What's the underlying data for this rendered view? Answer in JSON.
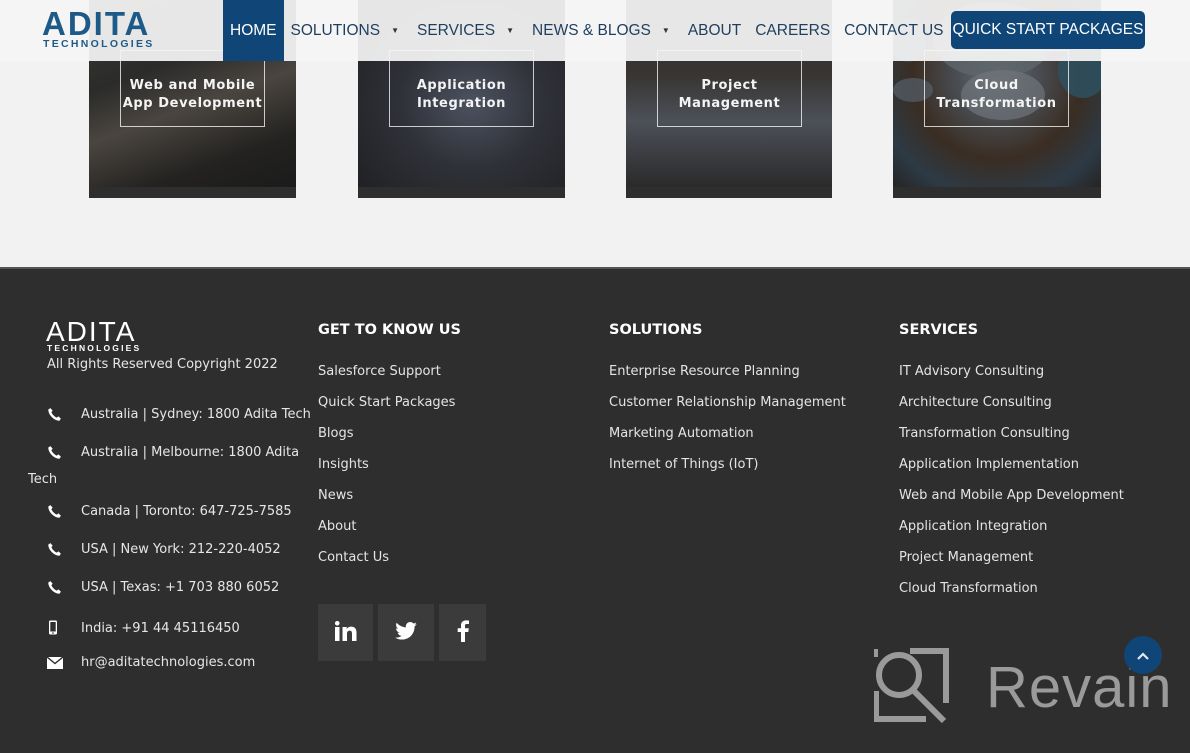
{
  "header": {
    "logo_main": "ADITA",
    "logo_sub": "TECHNOLOGIES",
    "nav": [
      {
        "label": "HOME",
        "active": true,
        "has_dropdown": false
      },
      {
        "label": "SOLUTIONS",
        "active": false,
        "has_dropdown": true
      },
      {
        "label": "SERVICES",
        "active": false,
        "has_dropdown": true
      },
      {
        "label": "NEWS & BLOGS",
        "active": false,
        "has_dropdown": true
      },
      {
        "label": "ABOUT",
        "active": false,
        "has_dropdown": false
      },
      {
        "label": "CAREERS",
        "active": false,
        "has_dropdown": false
      },
      {
        "label": "CONTACT US",
        "active": false,
        "has_dropdown": false
      }
    ],
    "dropdown_caret": "▼",
    "cta_label": "QUICK START PACKAGES"
  },
  "cards": [
    {
      "line1": "Web and Mobile",
      "line2": "App Development"
    },
    {
      "line1": "Application",
      "line2": "Integration"
    },
    {
      "line1": "Project",
      "line2": "Management"
    },
    {
      "line1": "Cloud",
      "line2": "Transformation"
    }
  ],
  "footer": {
    "logo_main": "ADITA",
    "logo_sub": "TECHNOLOGIES",
    "copyright": "All Rights Reserved Copyright 2022",
    "contacts": [
      {
        "icon": "phone-icon",
        "text": "Australia | Sydney: 1800 Adita Tech"
      },
      {
        "icon": "phone-icon",
        "text": "Australia | Melbourne: 1800 Adita",
        "wrap": "Tech"
      },
      {
        "icon": "phone-icon",
        "text": "Canada | Toronto: 647-725-7585"
      },
      {
        "icon": "phone-icon",
        "text": "USA | New York: 212-220-4052"
      },
      {
        "icon": "phone-icon",
        "text": "USA | Texas: +1 703 880 6052"
      },
      {
        "icon": "mobile-icon",
        "text": "India: +91 44 45116450"
      },
      {
        "icon": "envelope-icon",
        "text": "hr@aditatechnologies.com"
      }
    ],
    "columns": [
      {
        "title": "GET TO KNOW US",
        "links": [
          "Salesforce Support",
          "Quick Start Packages",
          "Blogs",
          "Insights",
          "News",
          "About",
          "Contact Us"
        ]
      },
      {
        "title": "SOLUTIONS",
        "links": [
          "Enterprise Resource Planning",
          "Customer Relationship Management",
          "Marketing Automation",
          "Internet of Things (IoT)"
        ]
      },
      {
        "title": "SERVICES",
        "links": [
          "IT Advisory Consulting",
          "Architecture Consulting",
          "Transformation Consulting",
          "Application Implementation",
          "Web and Mobile App Development",
          "Application Integration",
          "Project Management",
          "Cloud Transformation"
        ]
      }
    ],
    "socials": [
      {
        "name": "linkedin",
        "glyph": "in"
      },
      {
        "name": "twitter",
        "glyph": ""
      },
      {
        "name": "facebook",
        "glyph": "f"
      }
    ]
  },
  "watermark": {
    "text": "Revain"
  },
  "colors": {
    "brand_blue": "#0f4677",
    "footer_bg": "#2e2e2e",
    "page_bg": "#f2f2f2"
  }
}
